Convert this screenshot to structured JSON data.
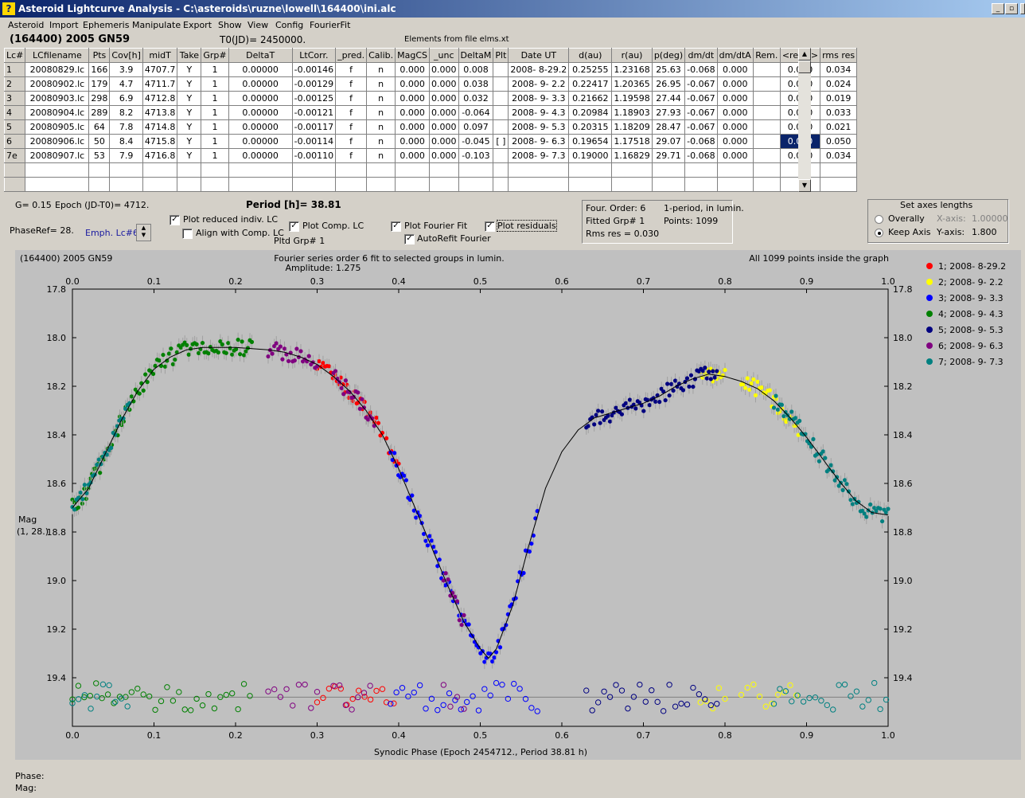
{
  "window": {
    "title": "Asteroid Lightcurve Analysis - C:\\asteroids\\ruzne\\lowell\\164400\\ini.alc",
    "minimize": "_",
    "restore": "▫",
    "close": "✕"
  },
  "menu": [
    "Asteroid",
    "Import",
    "Ephemeris",
    "Manipulate",
    "Export",
    "Show",
    "View",
    "Config",
    "FourierFit"
  ],
  "header": {
    "object": "(164400) 2005 GN59",
    "t0": "T0(JD)= 2450000.",
    "elements": "Elements from file elms.xt"
  },
  "table": {
    "columns": [
      "Lc#",
      "LCfilename",
      "Pts",
      "Cov[h]",
      "midT",
      "Take",
      "Grp#",
      "DeltaT",
      "LtCorr.",
      "_pred.",
      "Calib.",
      "MagCS",
      "_unc",
      "DeltaM",
      "Plt",
      "Date UT",
      "d(au)",
      "r(au)",
      "p(deg)",
      "dm/dt",
      "dm/dtA",
      "Rem.",
      "<resid>",
      "rms res"
    ],
    "rows": [
      [
        "1",
        "20080829.lc",
        "166",
        "3.9",
        "4707.7",
        "Y",
        "1",
        "0.00000",
        "-0.00146",
        "f",
        "n",
        "0.000",
        "0.000",
        "0.008",
        "",
        "2008- 8-29.2",
        "0.25255",
        "1.23168",
        "25.63",
        "-0.068",
        "0.000",
        "",
        "0.000",
        "0.034"
      ],
      [
        "2",
        "20080902.lc",
        "179",
        "4.7",
        "4711.7",
        "Y",
        "1",
        "0.00000",
        "-0.00129",
        "f",
        "n",
        "0.000",
        "0.000",
        "0.038",
        "",
        "2008- 9- 2.2",
        "0.22417",
        "1.20365",
        "26.95",
        "-0.067",
        "0.000",
        "",
        "0.000",
        "0.024"
      ],
      [
        "3",
        "20080903.lc",
        "298",
        "6.9",
        "4712.8",
        "Y",
        "1",
        "0.00000",
        "-0.00125",
        "f",
        "n",
        "0.000",
        "0.000",
        "0.032",
        "",
        "2008- 9- 3.3",
        "0.21662",
        "1.19598",
        "27.44",
        "-0.067",
        "0.000",
        "",
        "0.000",
        "0.019"
      ],
      [
        "4",
        "20080904.lc",
        "289",
        "8.2",
        "4713.8",
        "Y",
        "1",
        "0.00000",
        "-0.00121",
        "f",
        "n",
        "0.000",
        "0.000",
        "-0.064",
        "",
        "2008- 9- 4.3",
        "0.20984",
        "1.18903",
        "27.93",
        "-0.067",
        "0.000",
        "",
        "0.000",
        "0.033"
      ],
      [
        "5",
        "20080905.lc",
        "64",
        "7.8",
        "4714.8",
        "Y",
        "1",
        "0.00000",
        "-0.00117",
        "f",
        "n",
        "0.000",
        "0.000",
        "0.097",
        "",
        "2008- 9- 5.3",
        "0.20315",
        "1.18209",
        "28.47",
        "-0.067",
        "0.000",
        "",
        "0.000",
        "0.021"
      ],
      [
        "6",
        "20080906.lc",
        "50",
        "8.4",
        "4715.8",
        "Y",
        "1",
        "0.00000",
        "-0.00114",
        "f",
        "n",
        "0.000",
        "0.000",
        "-0.045",
        "[ ]",
        "2008- 9- 6.3",
        "0.19654",
        "1.17518",
        "29.07",
        "-0.068",
        "0.000",
        "",
        "0.000",
        "0.050"
      ],
      [
        "7e",
        "20080907.lc",
        "53",
        "7.9",
        "4716.8",
        "Y",
        "1",
        "0.00000",
        "-0.00110",
        "f",
        "n",
        "0.000",
        "0.000",
        "-0.103",
        "",
        "2008- 9- 7.3",
        "0.19000",
        "1.16829",
        "29.71",
        "-0.068",
        "0.000",
        "",
        "0.000",
        "0.034"
      ]
    ],
    "selected_cell": {
      "row": 5,
      "col": 22
    }
  },
  "controls": {
    "g": "G= 0.15",
    "epoch": "Epoch (JD-T0)= 4712.",
    "period": "Period [h]= 38.81",
    "phaseref": "PhaseRef= 28.",
    "emph": "Emph. Lc#6:",
    "plot_reduced": "Plot reduced indiv. LC",
    "align_comp": "Align with Comp. LC",
    "plot_comp": "Plot Comp. LC",
    "pltd_grp": "Pltd Grp#  1",
    "plot_fourier": "Plot Fourier Fit",
    "autorefit": "AutoRefit Fourier",
    "plot_residuals": "Plot residuals",
    "checked": {
      "plot_reduced": true,
      "align_comp": false,
      "plot_comp": true,
      "plot_fourier": true,
      "autorefit": true,
      "plot_residuals": true
    }
  },
  "fourier_info": {
    "order": "Four. Order:  6",
    "one_period": "1-period, in lumin.",
    "fitted": "Fitted Grp# 1",
    "points": "Points: 1099",
    "rms": "Rms res     = 0.030"
  },
  "axes_box": {
    "title": "Set axes lengths",
    "overally": "Overally",
    "keep_axis": "Keep Axis",
    "x_axis_label": "X-axis:",
    "x_axis_value": "1.00000",
    "y_axis_label": "Y-axis:",
    "y_axis_value": "1.800",
    "selected": "keep_axis"
  },
  "chart_data": {
    "type": "scatter",
    "title": "(164400) 2005 GN59",
    "subtitle": "Fourier series order 6 fit to selected groups in lumin.",
    "amplitude": "Amplitude: 1.275",
    "note": "All 1099 points inside the graph",
    "xlabel": "Synodic Phase (Epoch 2454712., Period 38.81 h)",
    "ylabel": "Mag",
    "ylabel2": "(1, 28.)",
    "xlim": [
      0,
      1
    ],
    "ylim": [
      17.8,
      19.6
    ],
    "y_inverted": true,
    "x_ticks": [
      "0.0",
      "0.1",
      "0.2",
      "0.3",
      "0.4",
      "0.5",
      "0.6",
      "0.7",
      "0.8",
      "0.9",
      "1.0"
    ],
    "y_ticks": [
      "17.8",
      "18.0",
      "18.2",
      "18.4",
      "18.6",
      "18.8",
      "19.0",
      "19.2",
      "19.4"
    ],
    "fourier_curve": [
      [
        0.0,
        18.7
      ],
      [
        0.02,
        18.62
      ],
      [
        0.04,
        18.48
      ],
      [
        0.06,
        18.34
      ],
      [
        0.08,
        18.22
      ],
      [
        0.1,
        18.13
      ],
      [
        0.12,
        18.08
      ],
      [
        0.14,
        18.05
      ],
      [
        0.16,
        18.04
      ],
      [
        0.18,
        18.04
      ],
      [
        0.2,
        18.04
      ],
      [
        0.22,
        18.045
      ],
      [
        0.24,
        18.05
      ],
      [
        0.26,
        18.06
      ],
      [
        0.28,
        18.08
      ],
      [
        0.3,
        18.11
      ],
      [
        0.32,
        18.16
      ],
      [
        0.34,
        18.22
      ],
      [
        0.36,
        18.3
      ],
      [
        0.38,
        18.4
      ],
      [
        0.4,
        18.54
      ],
      [
        0.42,
        18.7
      ],
      [
        0.44,
        18.86
      ],
      [
        0.46,
        19.02
      ],
      [
        0.48,
        19.17
      ],
      [
        0.5,
        19.28
      ],
      [
        0.51,
        19.32
      ],
      [
        0.52,
        19.28
      ],
      [
        0.54,
        19.1
      ],
      [
        0.56,
        18.85
      ],
      [
        0.58,
        18.62
      ],
      [
        0.6,
        18.47
      ],
      [
        0.62,
        18.38
      ],
      [
        0.64,
        18.33
      ],
      [
        0.66,
        18.31
      ],
      [
        0.68,
        18.29
      ],
      [
        0.7,
        18.27
      ],
      [
        0.72,
        18.24
      ],
      [
        0.74,
        18.2
      ],
      [
        0.76,
        18.17
      ],
      [
        0.78,
        18.15
      ],
      [
        0.8,
        18.16
      ],
      [
        0.82,
        18.18
      ],
      [
        0.84,
        18.21
      ],
      [
        0.86,
        18.26
      ],
      [
        0.88,
        18.33
      ],
      [
        0.9,
        18.41
      ],
      [
        0.92,
        18.5
      ],
      [
        0.94,
        18.59
      ],
      [
        0.96,
        18.67
      ],
      [
        0.98,
        18.72
      ],
      [
        1.0,
        18.73
      ]
    ],
    "series": [
      {
        "name": "1; 2008- 8-29.2",
        "color": "#ff0000",
        "x_ranges": [
          [
            0.3,
            0.38
          ],
          [
            0.385,
            0.4
          ]
        ]
      },
      {
        "name": "2; 2008- 9- 2.2",
        "color": "#ffff00",
        "x_ranges": [
          [
            0.77,
            0.8
          ],
          [
            0.82,
            0.89
          ]
        ]
      },
      {
        "name": "3; 2008- 9- 3.3",
        "color": "#0000ff",
        "x_ranges": [
          [
            0.39,
            0.57
          ]
        ]
      },
      {
        "name": "4; 2008- 9- 4.3",
        "color": "#008000",
        "x_ranges": [
          [
            0.0,
            0.22
          ]
        ]
      },
      {
        "name": "5; 2008- 9- 5.3",
        "color": "#000080",
        "x_ranges": [
          [
            0.63,
            0.79
          ]
        ]
      },
      {
        "name": "6; 2008- 9- 6.3",
        "color": "#800080",
        "x_ranges": [
          [
            0.24,
            0.3
          ],
          [
            0.32,
            0.37
          ],
          [
            0.455,
            0.48
          ]
        ]
      },
      {
        "name": "7; 2008- 9- 7.3",
        "color": "#008080",
        "x_ranges": [
          [
            0.0,
            0.07
          ],
          [
            0.86,
            1.0
          ]
        ]
      }
    ],
    "residual_baseline": 19.48
  },
  "status": {
    "phase": "Phase:",
    "mag": "Mag:"
  }
}
